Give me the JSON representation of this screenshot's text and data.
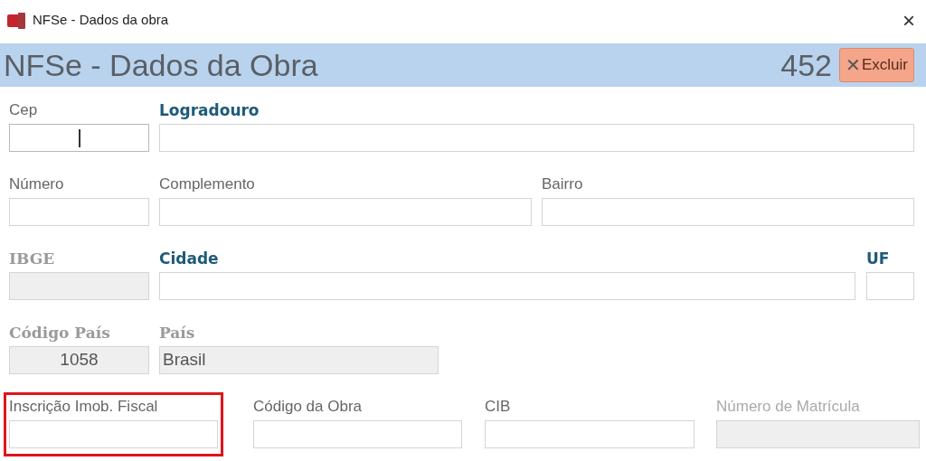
{
  "window": {
    "title": "NFSe - Dados da obra",
    "close": "×"
  },
  "header": {
    "title": "NFSe - Dados da Obra",
    "record_number": "452",
    "delete_button": {
      "icon": "✕",
      "label": "Excluir"
    }
  },
  "rows": [
    [
      {
        "label": "Cep",
        "kind": "plain",
        "focused": true,
        "highlighted": false
      },
      {
        "label": "Logradouro",
        "kind": "required",
        "focused": false,
        "highlighted": false
      }
    ],
    [
      {
        "label": "Número",
        "kind": "plain",
        "focused": false,
        "highlighted": false
      },
      {
        "label": "Complemento",
        "kind": "plain",
        "focused": false,
        "highlighted": false
      },
      {
        "label": "Bairro",
        "kind": "plain",
        "focused": false,
        "highlighted": false
      }
    ],
    [
      {
        "label": "IBGE",
        "kind": "locked",
        "focused": false,
        "highlighted": false
      },
      {
        "label": "Cidade",
        "kind": "required",
        "focused": false,
        "highlighted": false
      },
      {
        "label": "UF",
        "kind": "required",
        "focused": false,
        "highlighted": false
      }
    ],
    [
      {
        "label": "Código País",
        "kind": "locked",
        "value": "1058",
        "focused": false,
        "highlighted": false
      },
      {
        "label": "País",
        "kind": "locked",
        "value": "Brasil",
        "focused": false,
        "highlighted": false
      }
    ],
    [
      {
        "label": "Inscrição Imob. Fiscal",
        "kind": "plain",
        "focused": false,
        "highlighted": true
      },
      {
        "label": "Código da Obra",
        "kind": "plain",
        "focused": false,
        "highlighted": false
      },
      {
        "label": "CIB",
        "kind": "plain",
        "focused": false,
        "highlighted": false
      },
      {
        "label": "Número de Matrícula",
        "kind": "inactive",
        "focused": false,
        "highlighted": false
      }
    ]
  ]
}
